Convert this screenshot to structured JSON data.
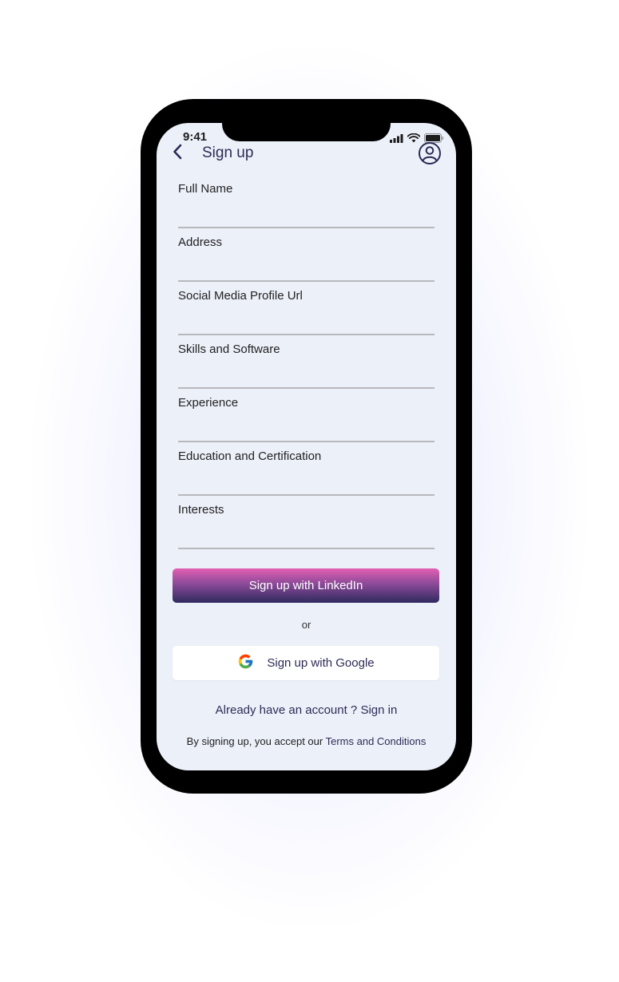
{
  "status_bar": {
    "time": "9:41"
  },
  "header": {
    "title": "Sign up",
    "back_icon": "chevron-left-icon",
    "profile_icon": "user-circle-icon"
  },
  "form": {
    "fields": [
      {
        "label": "Full Name",
        "value": ""
      },
      {
        "label": "Address",
        "value": ""
      },
      {
        "label": "Social Media Profile Url",
        "value": ""
      },
      {
        "label": "Skills and Software",
        "value": ""
      },
      {
        "label": "Experience",
        "value": ""
      },
      {
        "label": "Education and Certification",
        "value": ""
      },
      {
        "label": "Interests",
        "value": ""
      }
    ]
  },
  "actions": {
    "linkedin_label": "Sign up with LinkedIn",
    "or_text": "or",
    "google_label": "Sign up with Google",
    "google_icon": "google-g-icon"
  },
  "footer": {
    "have_account_text": "Already have an account ?",
    "signin_link": "Sign in",
    "terms_prefix": "By signing up, you accept our",
    "terms_link": "Terms and Conditions"
  },
  "colors": {
    "screen_background": "#ECF0F9",
    "primary_text": "#2d2b55",
    "linkedin_gradient_top": "#e35fb3",
    "linkedin_gradient_bottom": "#2e2a5e",
    "field_underline": "#b6b8bd"
  }
}
